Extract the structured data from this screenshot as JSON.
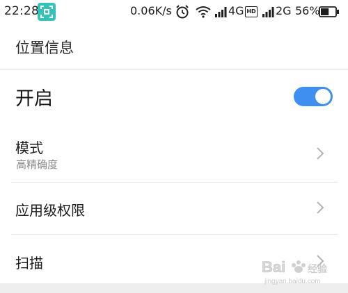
{
  "status_bar": {
    "time": "22:28",
    "net_speed": "0.06K/s",
    "network1": "4G",
    "hd_badge": "HD",
    "network2": "2G",
    "battery_percent": "56%",
    "battery_level": 0.56
  },
  "header": {
    "title": "位置信息"
  },
  "enable_row": {
    "label": "开启",
    "toggle_on": true
  },
  "rows": [
    {
      "label": "模式",
      "sub": "高精确度"
    },
    {
      "label": "应用级权限"
    },
    {
      "label": "扫描"
    }
  ],
  "watermark": {
    "brand": "Bai",
    "brand2": "经验",
    "url": "jingyan.baidu.com"
  },
  "colors": {
    "accent": "#3f8ff0",
    "scan_icon": "#35c2b8"
  }
}
